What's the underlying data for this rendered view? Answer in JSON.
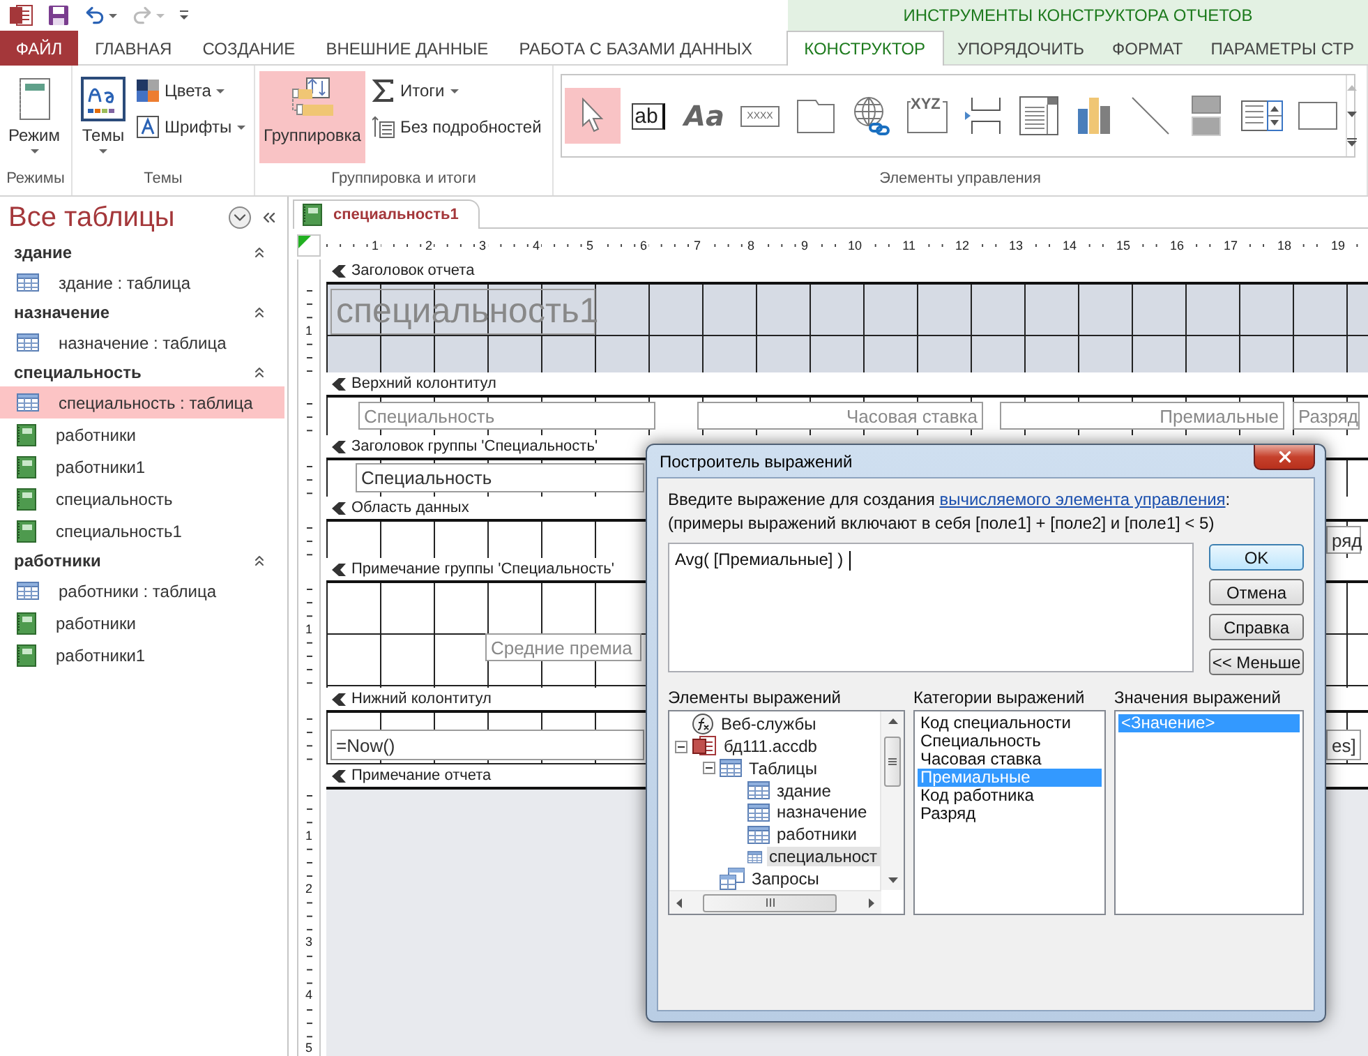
{
  "quick_access": [
    {
      "kind": "app"
    },
    {
      "kind": "save"
    },
    {
      "kind": "undo",
      "disabled": false
    },
    {
      "kind": "redo",
      "disabled": true
    },
    {
      "kind": "customize"
    }
  ],
  "context_title": "ИНСТРУМЕНТЫ КОНСТРУКТОРА ОТЧЕТОВ",
  "tabs": [
    {
      "label": "ФАЙЛ",
      "kind": "file",
      "selected": false
    },
    {
      "label": "ГЛАВНАЯ",
      "kind": "normal",
      "selected": false
    },
    {
      "label": "СОЗДАНИЕ",
      "kind": "normal",
      "selected": false
    },
    {
      "label": "ВНЕШНИЕ ДАННЫЕ",
      "kind": "normal",
      "selected": false
    },
    {
      "label": "РАБОТА С БАЗАМИ ДАННЫХ",
      "kind": "normal",
      "selected": false
    },
    {
      "label": "КОНСТРУКТОР",
      "kind": "context",
      "selected": true
    },
    {
      "label": "УПОРЯДОЧИТЬ",
      "kind": "context",
      "selected": false
    },
    {
      "label": "ФОРМАТ",
      "kind": "context",
      "selected": false
    },
    {
      "label": "ПАРАМЕТРЫ СТР",
      "kind": "context",
      "selected": false
    }
  ],
  "ribbon": [
    {
      "title": "Режимы",
      "items": [
        {
          "label": "Режим",
          "kind": "view",
          "dropdown": true,
          "selected": false
        }
      ]
    },
    {
      "title": "Темы",
      "items": [
        {
          "label": "Темы",
          "kind": "themes",
          "dropdown": true,
          "selected": false
        },
        {
          "label": "Цвета",
          "kind": "colors",
          "dropdown": true,
          "selected": false
        },
        {
          "label": "Шрифты",
          "kind": "fonts",
          "dropdown": true,
          "selected": false
        }
      ]
    },
    {
      "title": "Группировка и итоги",
      "items": [
        {
          "label": "Группировка",
          "kind": "grouping",
          "dropdown": false,
          "selected": true
        },
        {
          "label": "Итоги",
          "kind": "totals",
          "dropdown": true,
          "selected": false
        },
        {
          "label": "Без подробностей",
          "kind": "hide_details",
          "dropdown": false,
          "selected": false
        }
      ]
    },
    {
      "title": "Элементы управления",
      "gallery": [
        {
          "kind": "pointer",
          "selected": true
        },
        {
          "kind": "textbox",
          "glyph": "ab",
          "selected": false
        },
        {
          "kind": "label",
          "glyph": "Aa",
          "selected": false
        },
        {
          "kind": "button",
          "glyph": "XXXX",
          "selected": false
        },
        {
          "kind": "tab",
          "selected": false
        },
        {
          "kind": "hyperlink",
          "selected": false
        },
        {
          "kind": "frame",
          "glyph": "XYZ",
          "selected": false
        },
        {
          "kind": "pagebreak",
          "selected": false
        },
        {
          "kind": "combo",
          "selected": false
        },
        {
          "kind": "chart",
          "selected": false
        },
        {
          "kind": "line",
          "selected": false
        },
        {
          "kind": "toggle",
          "selected": false
        },
        {
          "kind": "listbox",
          "selected": false
        },
        {
          "kind": "rectangle",
          "selected": false
        }
      ]
    }
  ],
  "navigation": {
    "title": "Все таблицы",
    "groups": [
      {
        "name": "здание",
        "items": [
          {
            "label": "здание : таблица",
            "kind": "table",
            "selected": false
          }
        ]
      },
      {
        "name": "назначение",
        "items": [
          {
            "label": "назначение : таблица",
            "kind": "table",
            "selected": false
          }
        ]
      },
      {
        "name": "специальность",
        "items": [
          {
            "label": "специальность : таблица",
            "kind": "table",
            "selected": true
          },
          {
            "label": "работники",
            "kind": "report",
            "selected": false
          },
          {
            "label": "работники1",
            "kind": "report",
            "selected": false
          },
          {
            "label": "специальность",
            "kind": "report",
            "selected": false
          },
          {
            "label": "специальность1",
            "kind": "report",
            "selected": false
          }
        ]
      },
      {
        "name": "работники",
        "items": [
          {
            "label": "работники : таблица",
            "kind": "table",
            "selected": false
          },
          {
            "label": "работники",
            "kind": "report",
            "selected": false
          },
          {
            "label": "работники1",
            "kind": "report",
            "selected": false
          }
        ]
      }
    ]
  },
  "document_tab": "специальность1",
  "ruler": [
    "1",
    "2",
    "3",
    "4",
    "5",
    "6",
    "7",
    "8",
    "9",
    "10",
    "11",
    "12",
    "13",
    "14",
    "15",
    "16",
    "17",
    "18",
    "19"
  ],
  "sections": [
    {
      "title": "Заголовок отчета",
      "shaded": true,
      "ruler_marks": [
        "1"
      ],
      "controls": [
        {
          "kind": "title",
          "text": "специальность1"
        }
      ]
    },
    {
      "title": "Верхний колонтитул",
      "shaded": false,
      "controls": [
        {
          "kind": "label",
          "text": "Специальность"
        },
        {
          "kind": "label",
          "text": "Часовая ставка"
        },
        {
          "kind": "label",
          "text": "Премиальные"
        },
        {
          "kind": "label",
          "text": "Разряд"
        }
      ]
    },
    {
      "title": "Заголовок группы 'Специальность'",
      "shaded": false,
      "controls": [
        {
          "kind": "textbox",
          "text": "Специальность"
        }
      ]
    },
    {
      "title": "Область данных",
      "shaded": false,
      "controls": [
        {
          "kind": "textbox",
          "text": "ряд"
        }
      ]
    },
    {
      "title": "Примечание группы 'Специальность'",
      "shaded": false,
      "ruler_marks": [
        "1"
      ],
      "controls": [
        {
          "kind": "label",
          "text": "Средние премиа"
        }
      ]
    },
    {
      "title": "Нижний колонтитул",
      "shaded": false,
      "controls": [
        {
          "kind": "textbox",
          "text": "=Now()"
        },
        {
          "kind": "textbox",
          "text": "es]"
        }
      ]
    },
    {
      "title": "Примечание отчета"
    }
  ],
  "blank_ruler_marks": [
    "1",
    "2",
    "3",
    "4",
    "5"
  ],
  "dialog": {
    "title": "Построитель выражений",
    "prompt": {
      "text": "Введите выражение для создания ",
      "link": "вычисляемого элемента управления",
      "end": ":"
    },
    "example": "(примеры выражений включают в себя [поле1] + [поле2] и [поле1] < 5)",
    "expression": "Avg( [Премиальные] )",
    "buttons": [
      {
        "label": "OK",
        "default": true
      },
      {
        "label": "Отмена",
        "default": false
      },
      {
        "label": "Справка",
        "default": false
      },
      {
        "label": "<< Меньше",
        "default": false
      }
    ],
    "elements": {
      "title": "Элементы выражений",
      "tree": [
        {
          "label": "Веб-службы",
          "kind": "webservice",
          "selected": false
        },
        {
          "label": "бд111.accdb",
          "kind": "database",
          "expanded": true,
          "selected": false,
          "children": [
            {
              "label": "Таблицы",
              "kind": "tables",
              "expanded": true,
              "selected": false,
              "children": [
                {
                  "label": "здание",
                  "kind": "table",
                  "selected": false
                },
                {
                  "label": "назначение",
                  "kind": "table",
                  "selected": false
                },
                {
                  "label": "работники",
                  "kind": "table",
                  "selected": false
                },
                {
                  "label": "специальност",
                  "kind": "table",
                  "selected": true
                }
              ]
            },
            {
              "label": "Запросы",
              "kind": "queries",
              "selected": false
            }
          ]
        }
      ]
    },
    "categories": {
      "title": "Категории выражений",
      "items": [
        {
          "label": "Код специальности",
          "selected": false
        },
        {
          "label": "Специальность",
          "selected": false
        },
        {
          "label": "Часовая ставка",
          "selected": false
        },
        {
          "label": "Премиальные",
          "selected": true
        },
        {
          "label": "Код работника",
          "selected": false
        },
        {
          "label": "Разряд",
          "selected": false
        }
      ]
    },
    "values": {
      "title": "Значения выражений",
      "items": [
        {
          "label": "<Значение>",
          "selected": true
        }
      ]
    }
  }
}
